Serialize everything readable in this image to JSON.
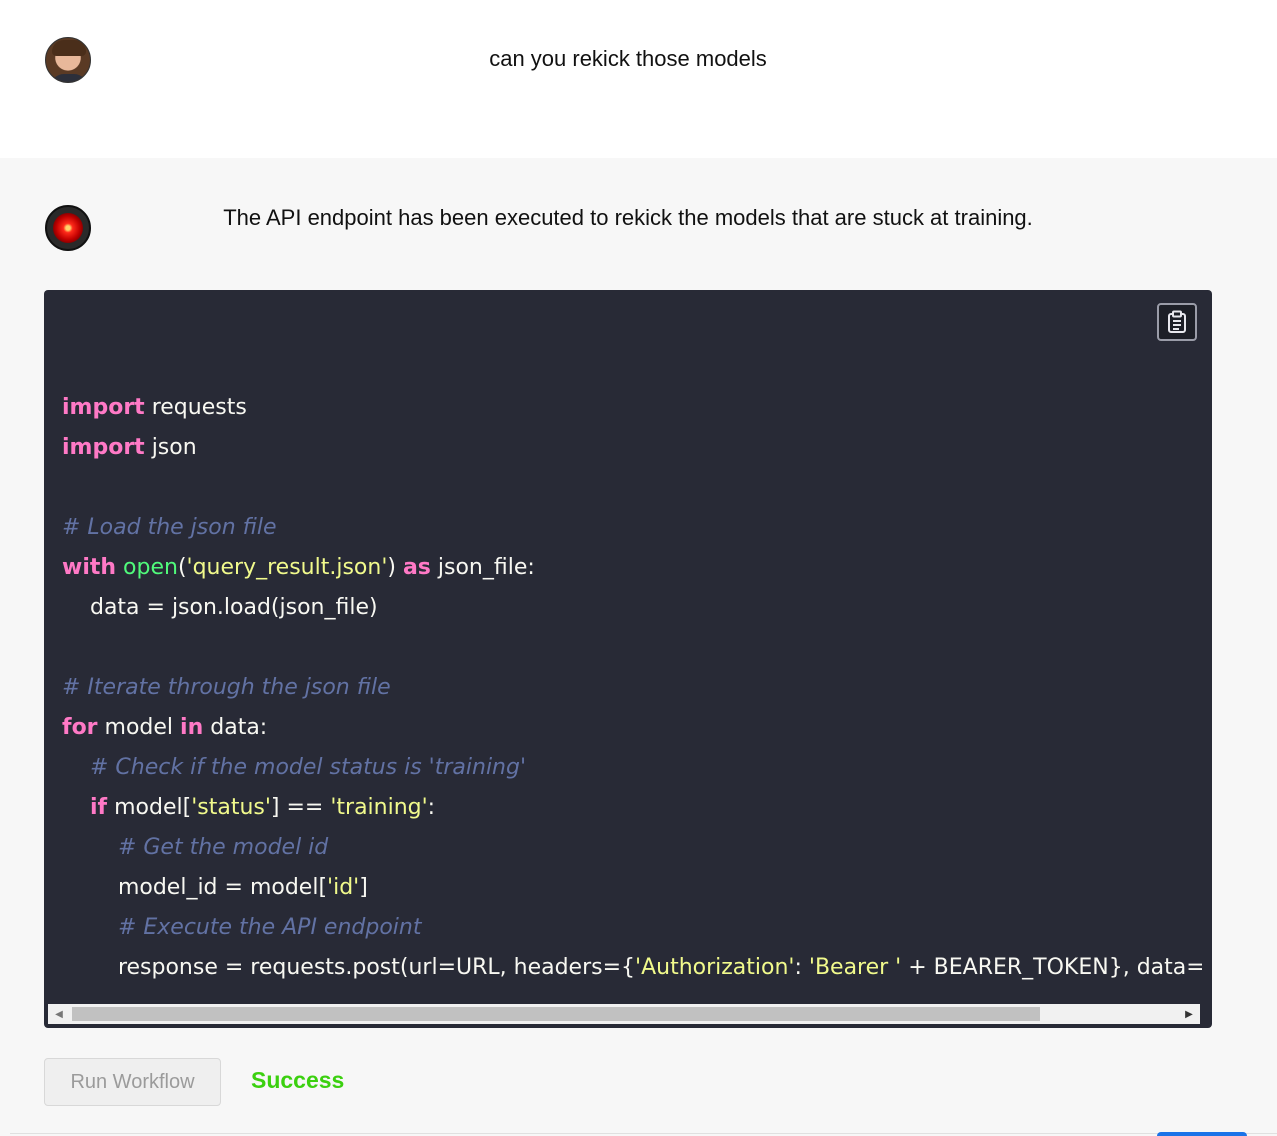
{
  "conversation": {
    "user_message": "can you rekick those models",
    "bot_message": "The API endpoint has been executed to rekick the models that are stuck at training.",
    "user_avatar_icon": "user-avatar",
    "bot_avatar_icon": "hal9000-eye-avatar"
  },
  "code_block": {
    "copy_icon": "clipboard-icon",
    "language": "python",
    "lines": [
      "import requests",
      "import json",
      "",
      "# Load the json file",
      "with open('query_result.json') as json_file:",
      "    data = json.load(json_file)",
      "",
      "# Iterate through the json file",
      "for model in data:",
      "    # Check if the model status is 'training'",
      "    if model['status'] == 'training':",
      "        # Get the model id",
      "        model_id = model['id']",
      "        # Execute the API endpoint",
      "        response = requests.post(url=URL, headers={'Authorization': 'Bearer ' + BEARER_TOKEN}, data={'model_"
    ],
    "scroll_fraction": 0.86
  },
  "actions": {
    "run_label": "Run Workflow",
    "status_text": "Success",
    "status_color": "#3bd00f"
  },
  "colors": {
    "code_bg": "#282a36",
    "keyword": "#ff79c6",
    "function": "#50fa7b",
    "string": "#f1fa8c",
    "comment": "#6272a4"
  }
}
